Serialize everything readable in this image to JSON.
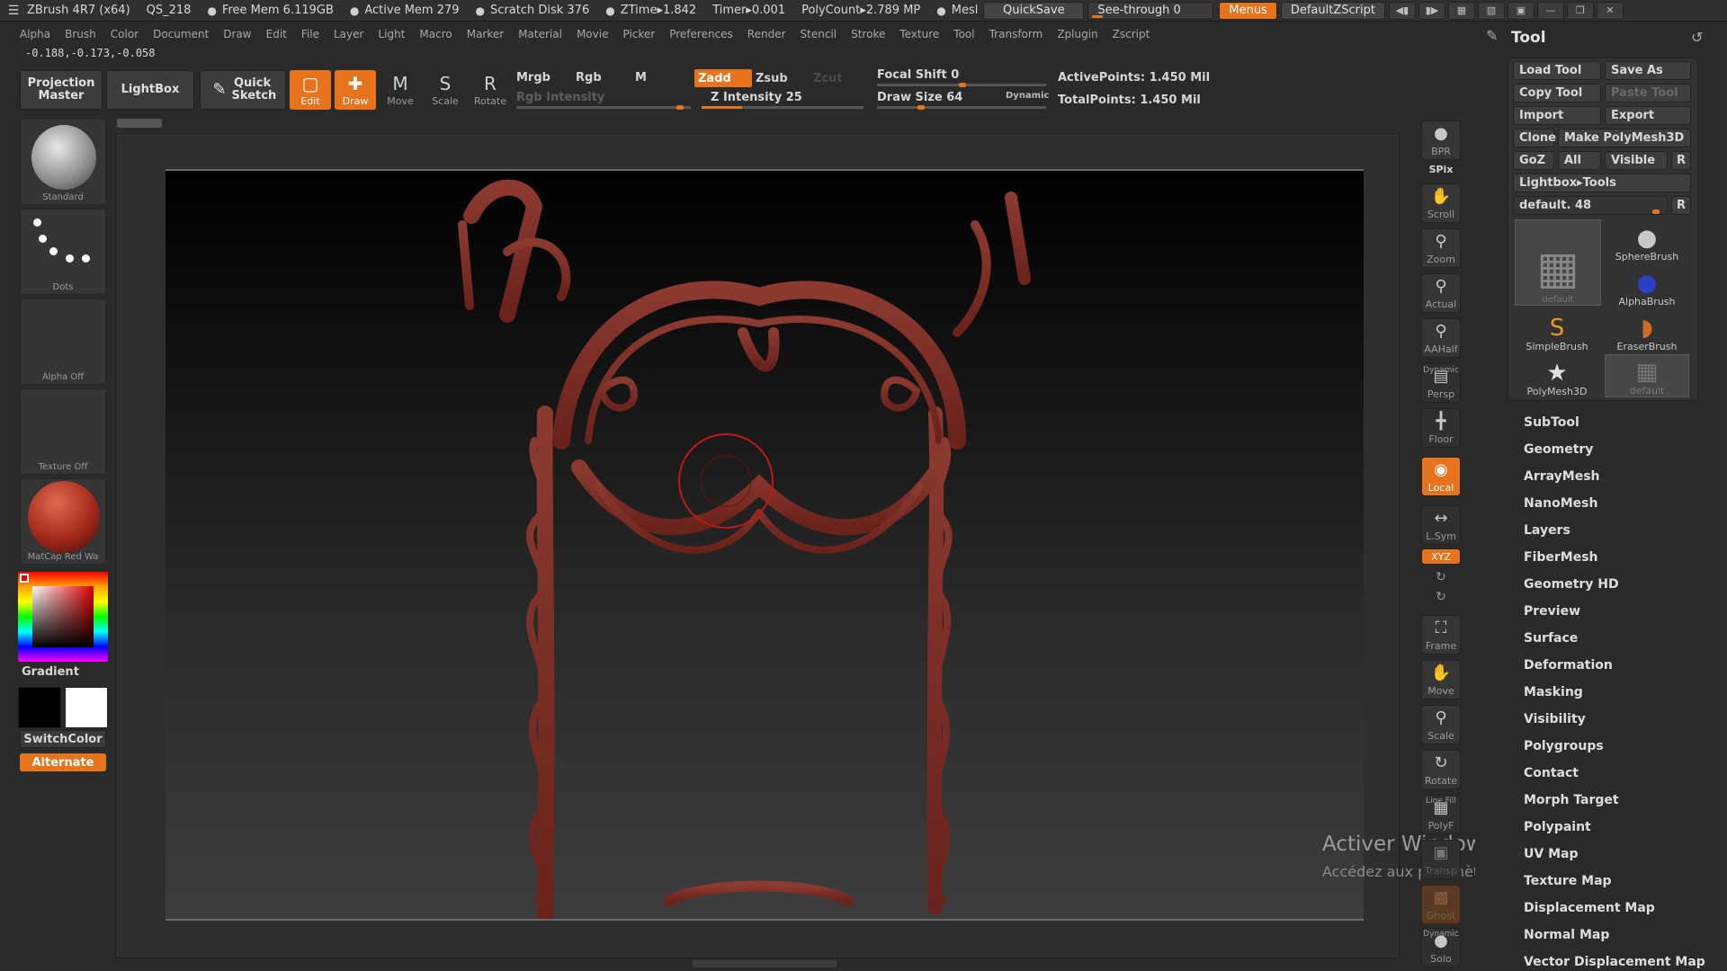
{
  "titlebar": {
    "app": "ZBrush 4R7 (x64)",
    "doc": "QS_218",
    "free_mem": "Free Mem 6.119GB",
    "active_mem": "Active Mem 279",
    "scratch": "Scratch Disk 376",
    "ztime": "ZTime▸1.842",
    "timer": "Timer▸0.001",
    "polycount": "PolyCount▸2.789 MP",
    "mesh": "Mesl",
    "quicksave": "QuickSave",
    "see_through": "See-through  0",
    "menus": "Menus",
    "script": "DefaultZScript"
  },
  "menubar": [
    "Alpha",
    "Brush",
    "Color",
    "Document",
    "Draw",
    "Edit",
    "File",
    "Layer",
    "Light",
    "Macro",
    "Marker",
    "Material",
    "Movie",
    "Picker",
    "Preferences",
    "Render",
    "Stencil",
    "Stroke",
    "Texture",
    "Tool",
    "Transform",
    "Zplugin",
    "Zscript"
  ],
  "coords": "-0.188,-0.173,-0.058",
  "toolbar": {
    "projection_master": "Projection Master",
    "lightbox": "LightBox",
    "quick_sketch": "Quick Sketch",
    "edit": "Edit",
    "draw": "Draw",
    "move": "Move",
    "scale": "Scale",
    "rotate": "Rotate",
    "mrgb": "Mrgb",
    "rgb": "Rgb",
    "m": "M",
    "rgb_intensity": "Rgb Intensity",
    "zadd": "Zadd",
    "zsub": "Zsub",
    "zcut": "Zcut",
    "z_intensity": "Z Intensity 25",
    "focal_shift": "Focal Shift 0",
    "draw_size": "Draw Size 64",
    "dynamic": "Dynamic",
    "active_points": "ActivePoints: 1.450 Mil",
    "total_points": "TotalPoints: 1.450 Mil",
    "z_intensity_value": 25,
    "focal_shift_value": 0,
    "draw_size_value": 64
  },
  "left_shelf": {
    "brush": "Standard",
    "stroke": "Dots",
    "alpha": "Alpha  Off",
    "texture": "Texture  Off",
    "material": "MatCap  Red  Wa",
    "gradient": "Gradient",
    "switch_color": "SwitchColor",
    "alternate": "Alternate"
  },
  "canvas": {
    "watermark_title": "Activer Windows",
    "watermark_sub": "Accédez aux paramètres pour activer Windows."
  },
  "right_strip": {
    "bpr": "BPR",
    "spix": "SPix",
    "scroll": "Scroll",
    "zoom": "Zoom",
    "actual": "Actual",
    "aahalf": "AAHalf",
    "dynamic": "Dynamic",
    "persp": "Persp",
    "floor": "Floor",
    "local": "Local",
    "lsym": "L.Sym",
    "xyz": "XYZ",
    "frame": "Frame",
    "move": "Move",
    "scale": "Scale",
    "rotate": "Rotate",
    "line_fill": "Line Fill",
    "polyf": "PolyF",
    "transp": "Transp",
    "ghost": "Ghost",
    "dynamic2": "Dynamic",
    "solo": "Solo"
  },
  "tool_panel": {
    "title": "Tool",
    "load_tool": "Load Tool",
    "save_as": "Save As",
    "copy_tool": "Copy Tool",
    "paste_tool": "Paste Tool",
    "import": "Import",
    "export": "Export",
    "clone": "Clone",
    "make_polymesh": "Make PolyMesh3D",
    "goz": "GoZ",
    "all": "All",
    "visible": "Visible",
    "r": "R",
    "lightbox_tools": "Lightbox▸Tools",
    "current_tool": "default. 48",
    "thumbs": [
      "default",
      "SphereBrush",
      "AlphaBrush",
      "SimpleBrush",
      "EraserBrush",
      "PolyMesh3D",
      "default"
    ],
    "sections": [
      "SubTool",
      "Geometry",
      "ArrayMesh",
      "NanoMesh",
      "Layers",
      "FiberMesh",
      "Geometry HD",
      "Preview",
      "Surface",
      "Deformation",
      "Masking",
      "Visibility",
      "Polygroups",
      "Contact",
      "Morph Target",
      "Polypaint",
      "UV Map",
      "Texture Map",
      "Displacement Map",
      "Normal Map",
      "Vector Displacement Map"
    ]
  },
  "colors": {
    "accent": "#e8731d",
    "sculpt": "#7a2a22",
    "brush_cursor": "#c01818"
  }
}
